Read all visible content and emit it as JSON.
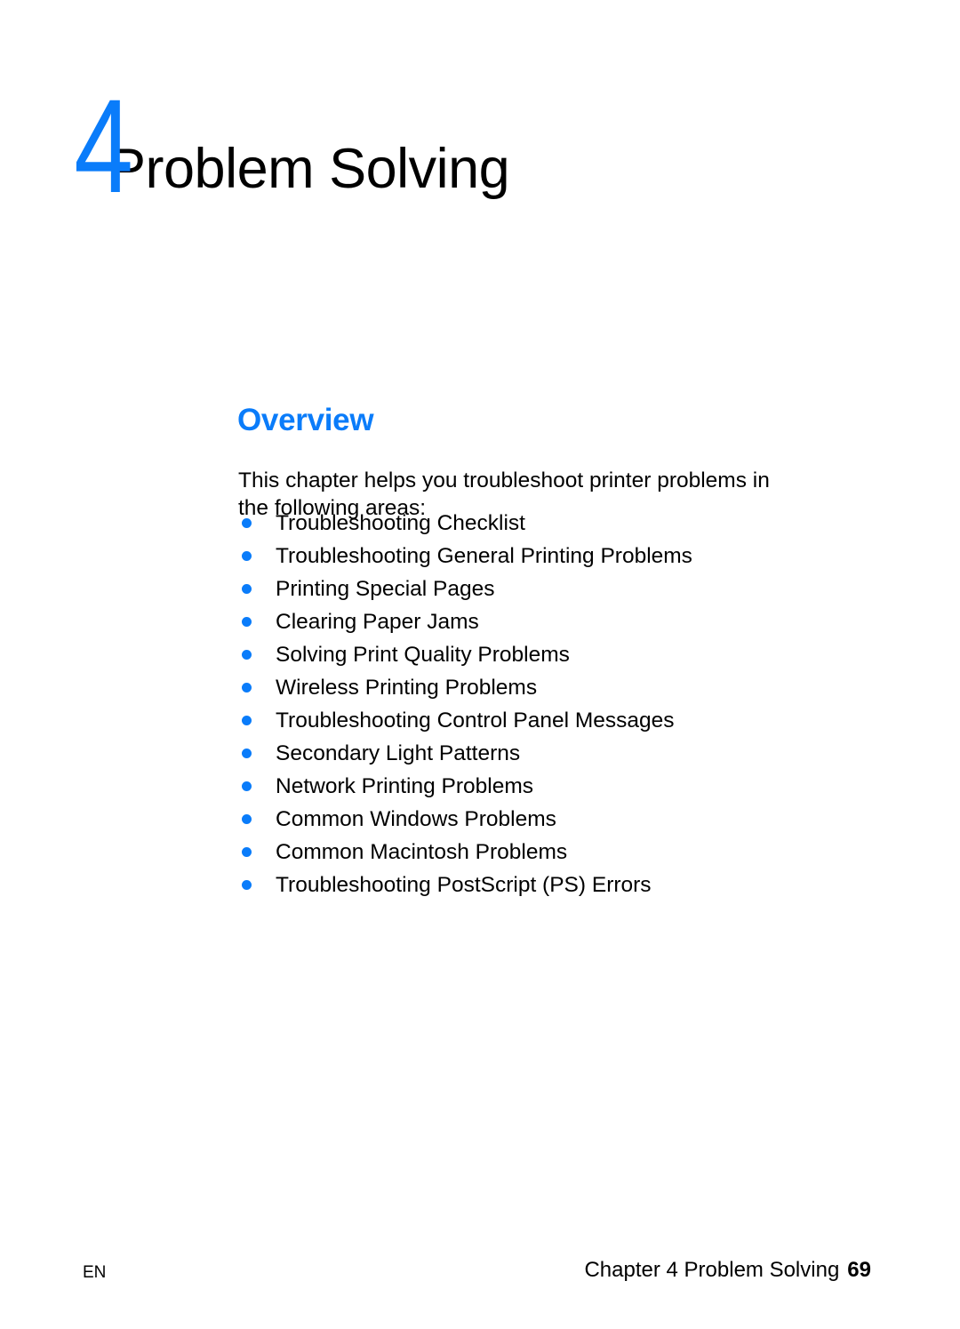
{
  "document": {
    "chapter": {
      "number": "4",
      "title": "Problem Solving"
    },
    "section": {
      "heading": "Overview",
      "intro": "This chapter helps you troubleshoot printer problems in the following areas:",
      "topics": [
        {
          "label": "Troubleshooting Checklist"
        },
        {
          "label": "Troubleshooting General Printing Problems"
        },
        {
          "label": "Printing Special Pages"
        },
        {
          "label": "Clearing Paper Jams"
        },
        {
          "label": "Solving Print Quality Problems"
        },
        {
          "label": "Wireless Printing Problems"
        },
        {
          "label": "Troubleshooting Control Panel Messages"
        },
        {
          "label": "Secondary Light Patterns"
        },
        {
          "label": "Network Printing Problems"
        },
        {
          "label": "Common Windows Problems"
        },
        {
          "label": "Common Macintosh Problems"
        },
        {
          "label": "Troubleshooting PostScript (PS) Errors"
        }
      ]
    },
    "footer": {
      "language": "EN",
      "chapter_text": "Chapter 4 Problem Solving",
      "page_number": "69"
    },
    "colors": {
      "accent_blue": "#0a7cfa",
      "body_text": "#000000",
      "page_background": "#ffffff"
    }
  }
}
